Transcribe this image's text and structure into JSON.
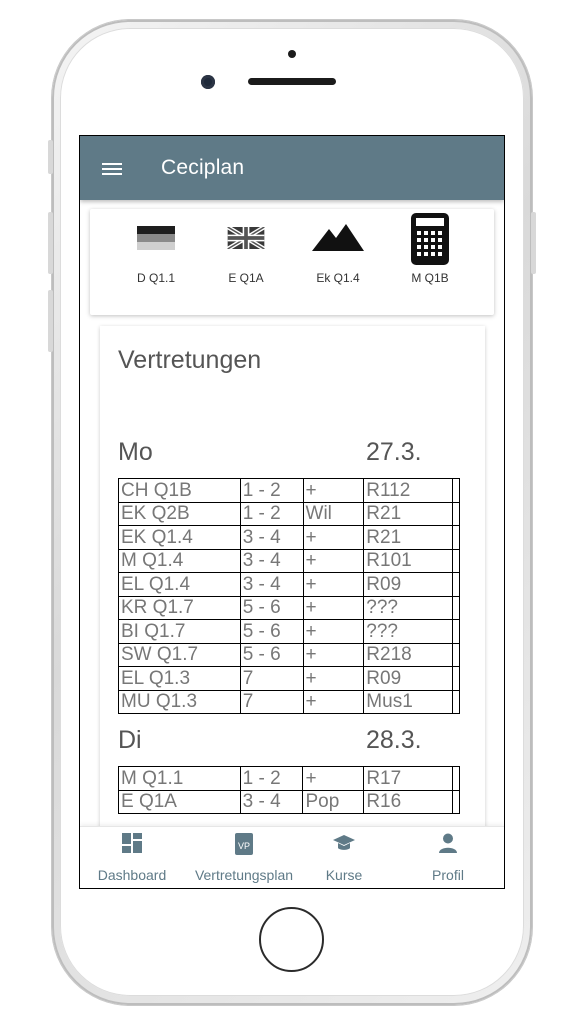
{
  "app": {
    "title": "Ceciplan"
  },
  "courses": [
    {
      "label": "D Q1.1",
      "icon": "german-flag-icon"
    },
    {
      "label": "E Q1A",
      "icon": "uk-flag-icon"
    },
    {
      "label": "Ek Q1.4",
      "icon": "mountain-icon"
    },
    {
      "label": "M Q1B",
      "icon": "calculator-icon"
    }
  ],
  "substitutions": {
    "title": "Vertretungen",
    "days": [
      {
        "day": "Mo",
        "date": "27.3.",
        "rows": [
          [
            "CH Q1B",
            "1 - 2",
            "+",
            "R112",
            ""
          ],
          [
            "EK Q2B",
            "1 - 2",
            "Wil",
            "R21",
            ""
          ],
          [
            "EK Q1.4",
            "3 - 4",
            "+",
            "R21",
            ""
          ],
          [
            "M Q1.4",
            "3 - 4",
            "+",
            "R101",
            ""
          ],
          [
            "EL Q1.4",
            "3 - 4",
            "+",
            "R09",
            ""
          ],
          [
            "KR Q1.7",
            "5 - 6",
            "+",
            "???",
            ""
          ],
          [
            "BI Q1.7",
            "5 - 6",
            "+",
            "???",
            ""
          ],
          [
            "SW Q1.7",
            "5 - 6",
            "+",
            "R218",
            ""
          ],
          [
            "EL Q1.3",
            "7",
            "+",
            "R09",
            ""
          ],
          [
            "MU Q1.3",
            "7",
            "+",
            "Mus1",
            ""
          ]
        ]
      },
      {
        "day": "Di",
        "date": "28.3.",
        "rows": [
          [
            "M Q1.1",
            "1 - 2",
            "+",
            "R17",
            ""
          ],
          [
            "E Q1A",
            "3 - 4",
            "Pop",
            "R16",
            ""
          ]
        ]
      }
    ]
  },
  "nav": {
    "dashboard": "Dashboard",
    "vertretungsplan": "Vertretungsplan",
    "vp_badge": "VP",
    "kurse": "Kurse",
    "profil": "Profil"
  },
  "colors": {
    "appbar": "#5f7a87",
    "nav_accent": "#5f7a87"
  }
}
